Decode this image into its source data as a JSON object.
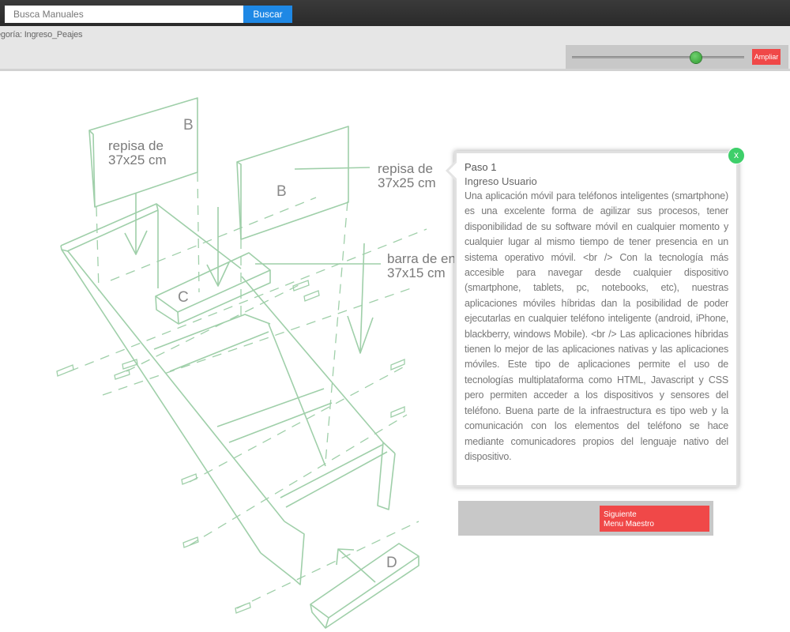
{
  "search": {
    "placeholder": "Busca Manuales",
    "button_label": "Buscar"
  },
  "breadcrumb": {
    "category_text": "egoría: Ingreso_Peajes"
  },
  "zoom": {
    "level": 0.72,
    "button_label": "Ampliar"
  },
  "illustration": {
    "labels": {
      "b_left": "B",
      "b_right": "B",
      "c": "C",
      "d": "D",
      "repisa_left_1": "repisa de",
      "repisa_left_2": "37x25 cm",
      "repisa_right_1": "repisa de",
      "repisa_right_2": "37x25 cm",
      "barra_1": "barra de en",
      "barra_2": "37x15 cm"
    },
    "line_color": "#9fcfa9"
  },
  "popup": {
    "close_label": "x",
    "step_title": "Paso 1",
    "step_subtitle": "Ingreso Usuario",
    "body": "Una aplicación móvil para teléfonos inteligentes (smartphone) es una excelente forma de agilizar sus procesos, tener disponibilidad de su software móvil en cualquier momento y cualquier lugar al mismo tiempo de tener presencia en un sistema operativo móvil. <br /> Con la tecnología más accesible para navegar desde cualquier dispositivo (smartphone, tablets, pc, notebooks, etc), nuestras aplicaciones móviles híbridas dan la posibilidad de poder ejecutarlas en cualquier teléfono inteligente (android, iPhone, blackberry, windows Mobile). <br /> Las aplicaciones híbridas tienen lo mejor de las aplicaciones nativas y las aplicaciones móviles. Este tipo de aplicaciones permite el uso de tecnologías multiplataforma como HTML, Javascript y CSS pero permiten acceder a los dispositivos y sensores del teléfono. Buena parte de la infraestructura es tipo web y la comunicación con los elementos del teléfono se hace mediante comunicadores propios del lenguaje nativo del dispositivo."
  },
  "next_button": {
    "line1": "Siguiente",
    "line2": "Menu Maestro"
  }
}
